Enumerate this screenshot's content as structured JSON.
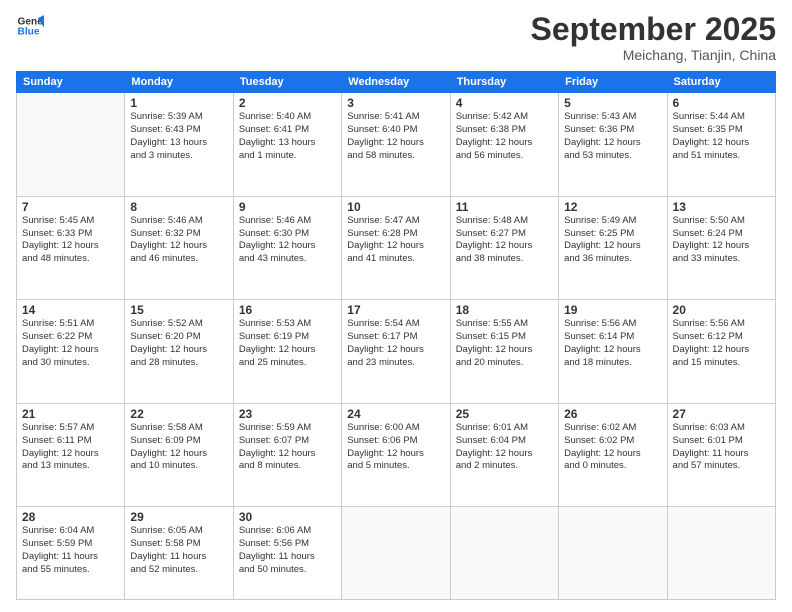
{
  "header": {
    "logo_line1": "General",
    "logo_line2": "Blue",
    "month_title": "September 2025",
    "location": "Meichang, Tianjin, China"
  },
  "weekdays": [
    "Sunday",
    "Monday",
    "Tuesday",
    "Wednesday",
    "Thursday",
    "Friday",
    "Saturday"
  ],
  "weeks": [
    [
      {
        "day": "",
        "info": ""
      },
      {
        "day": "1",
        "info": "Sunrise: 5:39 AM\nSunset: 6:43 PM\nDaylight: 13 hours\nand 3 minutes."
      },
      {
        "day": "2",
        "info": "Sunrise: 5:40 AM\nSunset: 6:41 PM\nDaylight: 13 hours\nand 1 minute."
      },
      {
        "day": "3",
        "info": "Sunrise: 5:41 AM\nSunset: 6:40 PM\nDaylight: 12 hours\nand 58 minutes."
      },
      {
        "day": "4",
        "info": "Sunrise: 5:42 AM\nSunset: 6:38 PM\nDaylight: 12 hours\nand 56 minutes."
      },
      {
        "day": "5",
        "info": "Sunrise: 5:43 AM\nSunset: 6:36 PM\nDaylight: 12 hours\nand 53 minutes."
      },
      {
        "day": "6",
        "info": "Sunrise: 5:44 AM\nSunset: 6:35 PM\nDaylight: 12 hours\nand 51 minutes."
      }
    ],
    [
      {
        "day": "7",
        "info": "Sunrise: 5:45 AM\nSunset: 6:33 PM\nDaylight: 12 hours\nand 48 minutes."
      },
      {
        "day": "8",
        "info": "Sunrise: 5:46 AM\nSunset: 6:32 PM\nDaylight: 12 hours\nand 46 minutes."
      },
      {
        "day": "9",
        "info": "Sunrise: 5:46 AM\nSunset: 6:30 PM\nDaylight: 12 hours\nand 43 minutes."
      },
      {
        "day": "10",
        "info": "Sunrise: 5:47 AM\nSunset: 6:28 PM\nDaylight: 12 hours\nand 41 minutes."
      },
      {
        "day": "11",
        "info": "Sunrise: 5:48 AM\nSunset: 6:27 PM\nDaylight: 12 hours\nand 38 minutes."
      },
      {
        "day": "12",
        "info": "Sunrise: 5:49 AM\nSunset: 6:25 PM\nDaylight: 12 hours\nand 36 minutes."
      },
      {
        "day": "13",
        "info": "Sunrise: 5:50 AM\nSunset: 6:24 PM\nDaylight: 12 hours\nand 33 minutes."
      }
    ],
    [
      {
        "day": "14",
        "info": "Sunrise: 5:51 AM\nSunset: 6:22 PM\nDaylight: 12 hours\nand 30 minutes."
      },
      {
        "day": "15",
        "info": "Sunrise: 5:52 AM\nSunset: 6:20 PM\nDaylight: 12 hours\nand 28 minutes."
      },
      {
        "day": "16",
        "info": "Sunrise: 5:53 AM\nSunset: 6:19 PM\nDaylight: 12 hours\nand 25 minutes."
      },
      {
        "day": "17",
        "info": "Sunrise: 5:54 AM\nSunset: 6:17 PM\nDaylight: 12 hours\nand 23 minutes."
      },
      {
        "day": "18",
        "info": "Sunrise: 5:55 AM\nSunset: 6:15 PM\nDaylight: 12 hours\nand 20 minutes."
      },
      {
        "day": "19",
        "info": "Sunrise: 5:56 AM\nSunset: 6:14 PM\nDaylight: 12 hours\nand 18 minutes."
      },
      {
        "day": "20",
        "info": "Sunrise: 5:56 AM\nSunset: 6:12 PM\nDaylight: 12 hours\nand 15 minutes."
      }
    ],
    [
      {
        "day": "21",
        "info": "Sunrise: 5:57 AM\nSunset: 6:11 PM\nDaylight: 12 hours\nand 13 minutes."
      },
      {
        "day": "22",
        "info": "Sunrise: 5:58 AM\nSunset: 6:09 PM\nDaylight: 12 hours\nand 10 minutes."
      },
      {
        "day": "23",
        "info": "Sunrise: 5:59 AM\nSunset: 6:07 PM\nDaylight: 12 hours\nand 8 minutes."
      },
      {
        "day": "24",
        "info": "Sunrise: 6:00 AM\nSunset: 6:06 PM\nDaylight: 12 hours\nand 5 minutes."
      },
      {
        "day": "25",
        "info": "Sunrise: 6:01 AM\nSunset: 6:04 PM\nDaylight: 12 hours\nand 2 minutes."
      },
      {
        "day": "26",
        "info": "Sunrise: 6:02 AM\nSunset: 6:02 PM\nDaylight: 12 hours\nand 0 minutes."
      },
      {
        "day": "27",
        "info": "Sunrise: 6:03 AM\nSunset: 6:01 PM\nDaylight: 11 hours\nand 57 minutes."
      }
    ],
    [
      {
        "day": "28",
        "info": "Sunrise: 6:04 AM\nSunset: 5:59 PM\nDaylight: 11 hours\nand 55 minutes."
      },
      {
        "day": "29",
        "info": "Sunrise: 6:05 AM\nSunset: 5:58 PM\nDaylight: 11 hours\nand 52 minutes."
      },
      {
        "day": "30",
        "info": "Sunrise: 6:06 AM\nSunset: 5:56 PM\nDaylight: 11 hours\nand 50 minutes."
      },
      {
        "day": "",
        "info": ""
      },
      {
        "day": "",
        "info": ""
      },
      {
        "day": "",
        "info": ""
      },
      {
        "day": "",
        "info": ""
      }
    ]
  ]
}
